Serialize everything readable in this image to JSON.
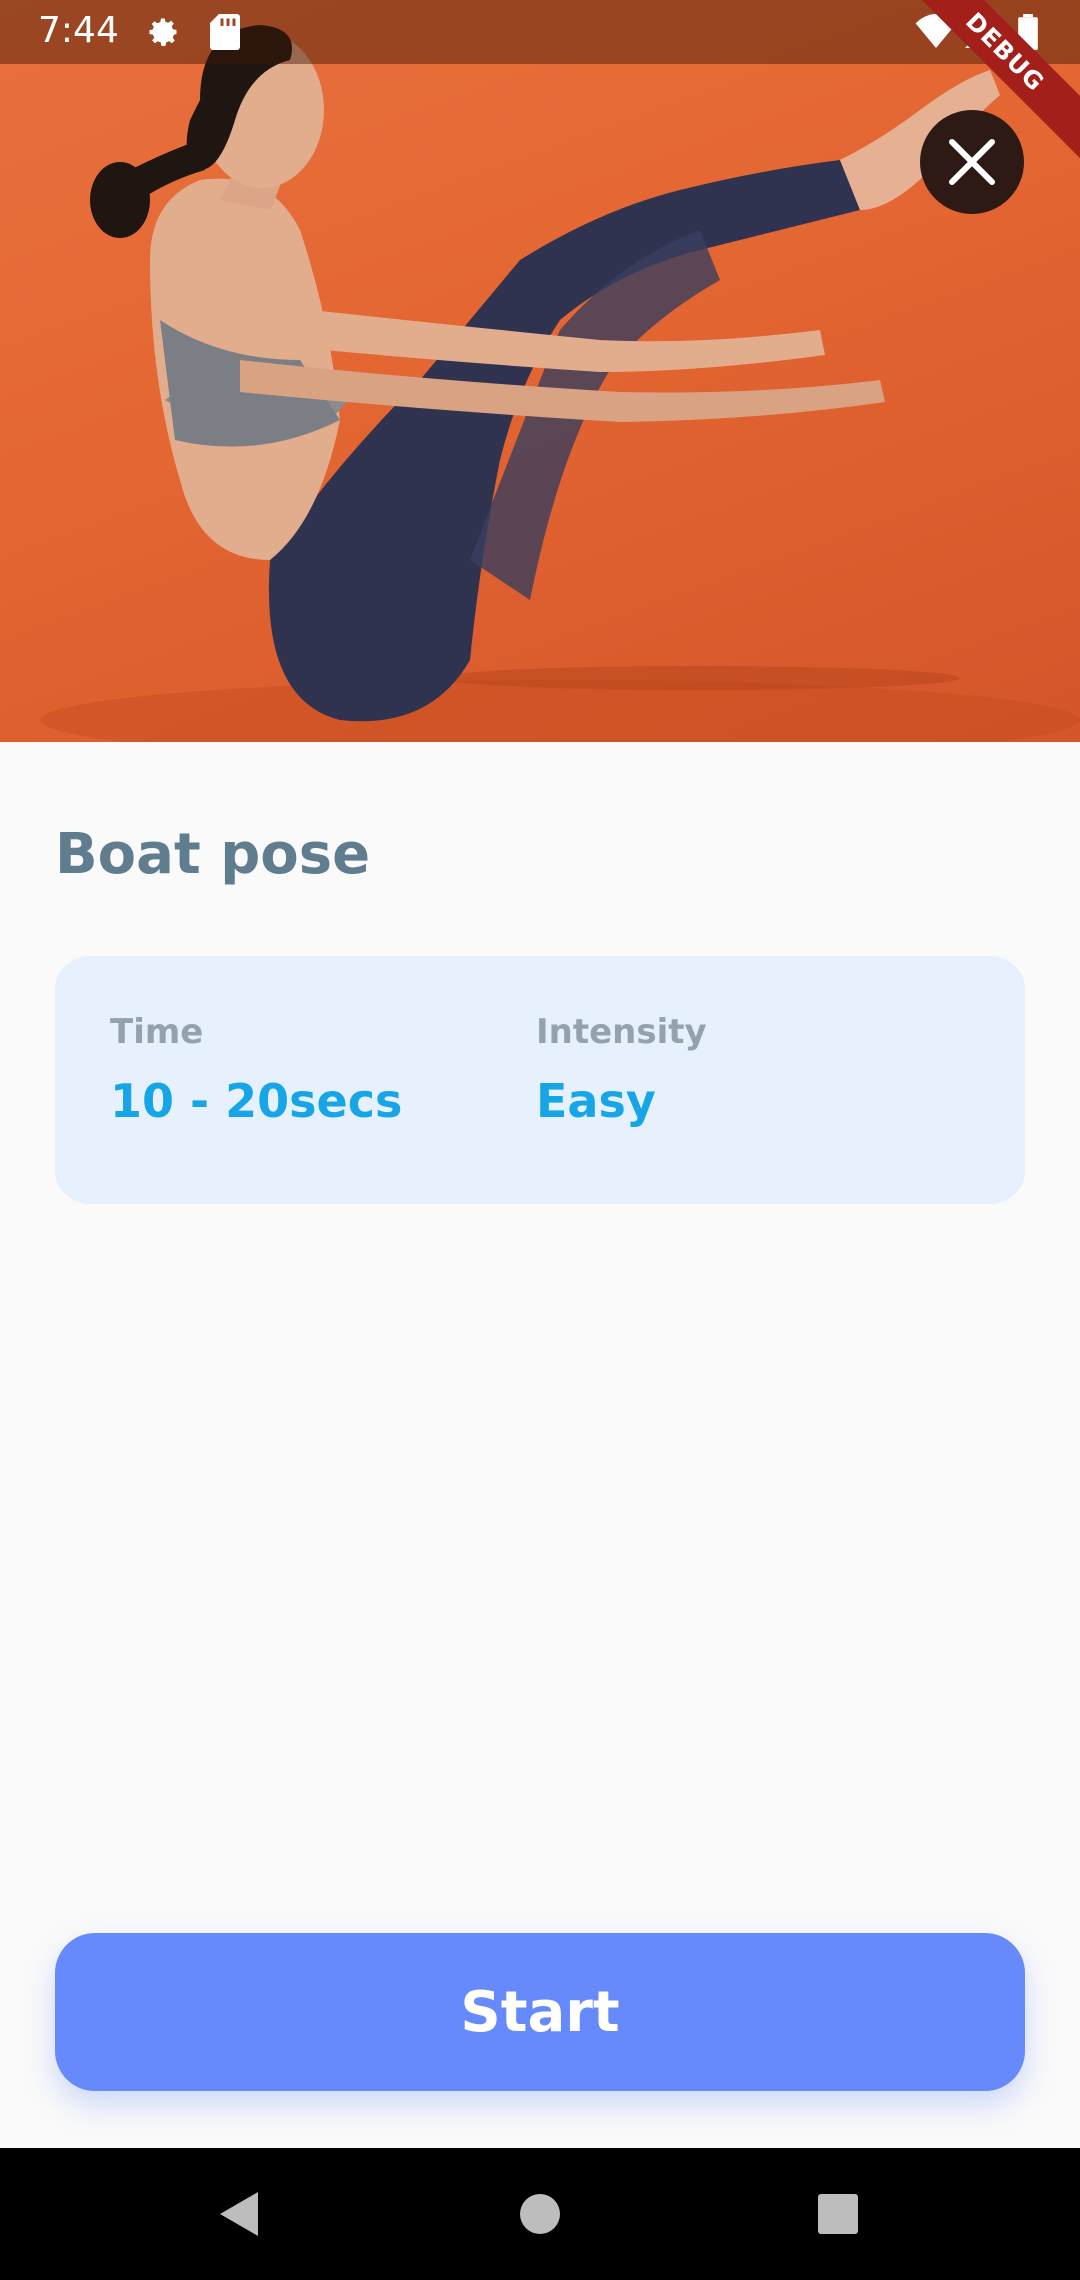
{
  "status_bar": {
    "time": "7:44",
    "icons": [
      "gear-icon",
      "sd-card-icon",
      "wifi-icon",
      "signal-icon",
      "battery-icon"
    ]
  },
  "debug_banner": "DEBUG",
  "hero": {
    "description_icon": "yoga-boat-pose-photo",
    "background_color": "#e4662f",
    "close_icon": "close-icon"
  },
  "exercise": {
    "title": "Boat pose"
  },
  "info_card": {
    "time_label": "Time",
    "time_value": "10 - 20secs",
    "intensity_label": "Intensity",
    "intensity_value": "Easy"
  },
  "start_button": {
    "label": "Start",
    "color": "#6689fb"
  },
  "navigation_bar": {
    "icons": [
      "back-icon",
      "home-icon",
      "recents-icon"
    ]
  },
  "colors": {
    "title": "#5f7d8e",
    "accent_value": "#16a6e8",
    "card_bg": "#e7f1fe",
    "label": "#93a2ad"
  }
}
